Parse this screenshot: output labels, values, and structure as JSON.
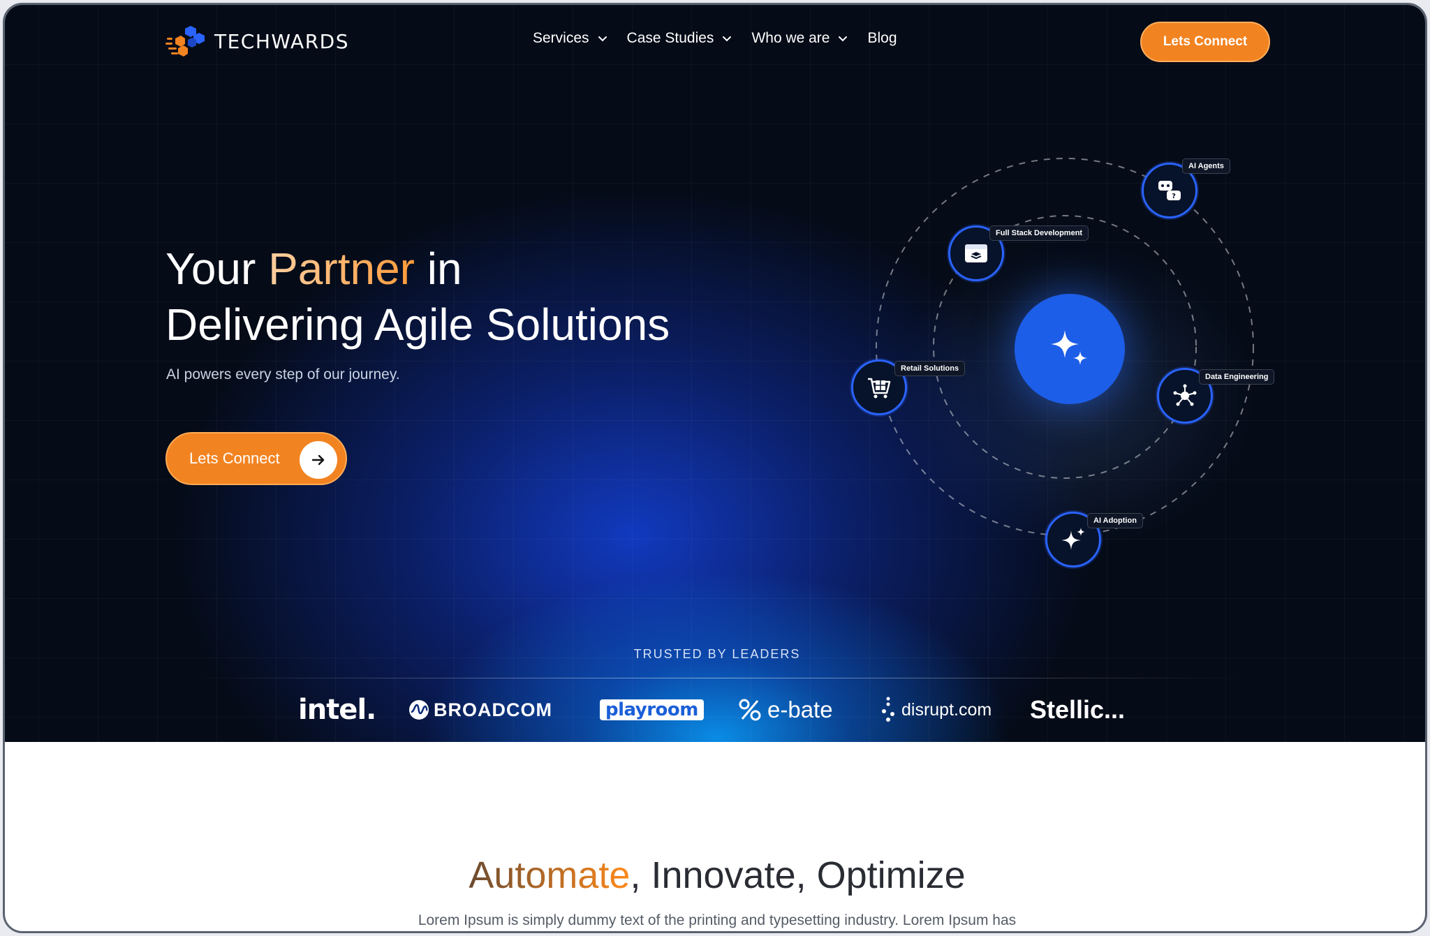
{
  "brand": {
    "name": "TECHWARDS",
    "accent": "#f28321",
    "blue": "#1d5ee8"
  },
  "nav": {
    "items": [
      {
        "label": "Services",
        "has_dropdown": true
      },
      {
        "label": "Case Studies",
        "has_dropdown": true
      },
      {
        "label": "Who we are",
        "has_dropdown": true
      },
      {
        "label": "Blog",
        "has_dropdown": false
      }
    ],
    "cta": "Lets Connect"
  },
  "hero": {
    "title_part1": "Your ",
    "title_accent": "Partner",
    "title_part2": " in",
    "title_line2": "Delivering Agile Solutions",
    "subtitle": "AI powers every step of our journey.",
    "cta": "Lets Connect"
  },
  "orbit": {
    "center_icon": "sparkles-icon",
    "nodes": [
      {
        "label": "AI Agents",
        "icon": "chat-bot-icon"
      },
      {
        "label": "Full Stack Development",
        "icon": "browser-window-icon"
      },
      {
        "label": "Retail Solutions",
        "icon": "shopping-cart-icon"
      },
      {
        "label": "Data Engineering",
        "icon": "network-hub-icon"
      },
      {
        "label": "AI Adoption",
        "icon": "sparkle-icon"
      }
    ]
  },
  "trusted": {
    "heading": "TRUSTED BY LEADERS",
    "logos": [
      "intel.",
      "BROADCOM",
      "playroom",
      "e-bate",
      "disrupt.com",
      "Stellic..."
    ]
  },
  "section": {
    "title_accent": "Automate",
    "title_rest": ", Innovate, Optimize",
    "body": "Lorem Ipsum is simply dummy text of the printing and typesetting industry. Lorem Ipsum has"
  }
}
